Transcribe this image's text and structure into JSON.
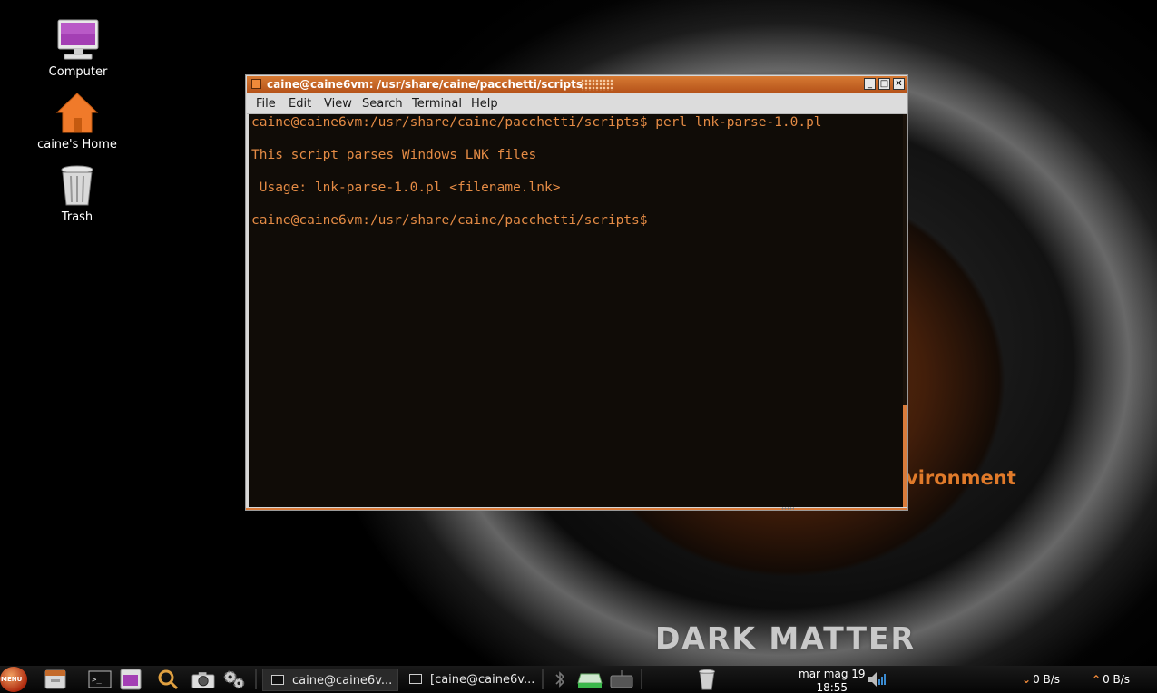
{
  "desktop": {
    "icons": [
      {
        "label": "Computer",
        "icon": "computer-icon"
      },
      {
        "label": "caine's Home",
        "icon": "home-folder-icon"
      },
      {
        "label": "Trash",
        "icon": "trash-icon"
      }
    ],
    "wallpaper": {
      "text_environment": "vironment",
      "text_darkmatter": "DARK MATTER"
    }
  },
  "terminal": {
    "title": "caine@caine6vm: /usr/share/caine/pacchetti/scripts",
    "controls": {
      "minimize": "_",
      "maximize": "□",
      "close": "✕"
    },
    "menu": [
      "File",
      "Edit",
      "View",
      "Search",
      "Terminal",
      "Help"
    ],
    "lines": [
      "caine@caine6vm:/usr/share/caine/pacchetti/scripts$ perl lnk-parse-1.0.pl",
      "",
      "This script parses Windows LNK files",
      "",
      " Usage: lnk-parse-1.0.pl <filename.lnk>",
      "",
      "caine@caine6vm:/usr/share/caine/pacchetti/scripts$"
    ],
    "colors": {
      "text": "#e48b45",
      "background": "#100c07",
      "accent": "#d97b3a"
    }
  },
  "taskbar": {
    "menu_label": "MENU",
    "tasks": [
      {
        "label": "caine@caine6v...",
        "active": true
      },
      {
        "label": "[caine@caine6v...",
        "active": false
      }
    ],
    "clock": {
      "date": "mar mag 19",
      "time": "18:55"
    },
    "net_down": "0 B/s",
    "net_up": "0 B/s"
  }
}
